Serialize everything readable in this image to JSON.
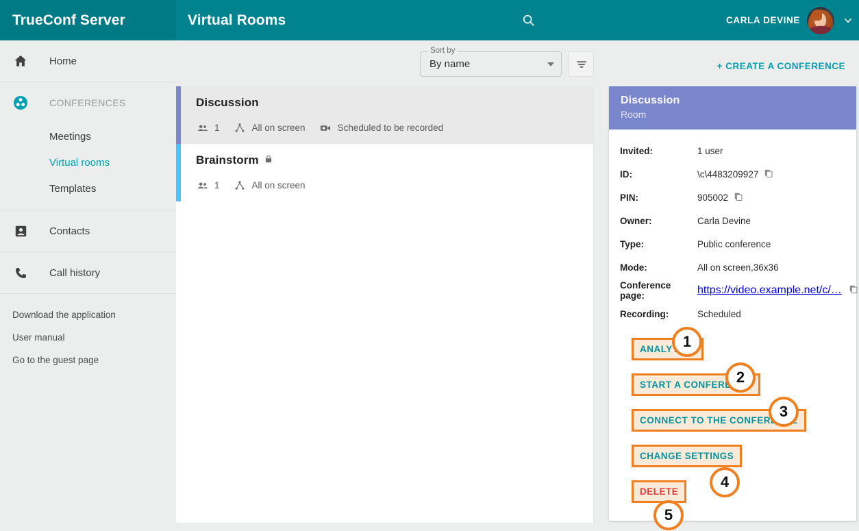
{
  "topbar": {
    "brand": "TrueConf Server",
    "page_title": "Virtual Rooms",
    "search_icon": "search-icon",
    "user_name": "CARLA DEVINE",
    "chevron": "❯"
  },
  "sidebar": {
    "home": {
      "label": "Home",
      "icon": "home-icon"
    },
    "conferences": {
      "label": "CONFERENCES",
      "icon": "conference-group-icon"
    },
    "sub_items": [
      {
        "label": "Meetings",
        "active": false
      },
      {
        "label": "Virtual rooms",
        "active": true
      },
      {
        "label": "Templates",
        "active": false
      }
    ],
    "contacts": {
      "label": "Contacts",
      "icon": "contact-card-icon"
    },
    "call_history": {
      "label": "Call history",
      "icon": "phone-icon"
    },
    "links": [
      "Download the application",
      "User manual",
      "Go to the guest page"
    ]
  },
  "toolbar": {
    "sort_legend": "Sort by",
    "sort_value": "By name",
    "sort_options": [
      "By name"
    ],
    "filter_icon": "filter-icon",
    "create_label": "+ CREATE A CONFERENCE"
  },
  "list": [
    {
      "title": "Discussion",
      "locked": false,
      "bar_color": "#7986cb",
      "selected": true,
      "meta": [
        {
          "icon": "group-icon",
          "text": "1"
        },
        {
          "icon": "topology-icon",
          "text": "All on screen"
        },
        {
          "icon": "video-camera-icon",
          "text": "Scheduled to be recorded"
        }
      ]
    },
    {
      "title": "Brainstorm",
      "locked": true,
      "lock_icon": "lock-icon",
      "bar_color": "#4fc3f7",
      "selected": false,
      "meta": [
        {
          "icon": "group-icon",
          "text": "1"
        },
        {
          "icon": "topology-icon",
          "text": "All on screen"
        }
      ]
    }
  ],
  "detail": {
    "title": "Discussion",
    "subtitle": "Room",
    "header_color": "#7986cb",
    "rows": [
      {
        "label": "Invited:",
        "value": "1 user",
        "copy": false
      },
      {
        "label": "ID:",
        "value": "\\c\\4483209927",
        "copy": true
      },
      {
        "label": "PIN:",
        "value": "905002",
        "copy": true
      },
      {
        "label": "Owner:",
        "value": "Carla Devine",
        "copy": false
      },
      {
        "label": "Type:",
        "value": "Public conference",
        "copy": false
      },
      {
        "label": "Mode:",
        "value": "All on screen,36x36",
        "copy": false
      },
      {
        "label": "Conference page:",
        "value": "https://video.example.net/c/…",
        "copy": true,
        "link": true
      },
      {
        "label": "Recording:",
        "value": "Scheduled",
        "copy": false
      }
    ],
    "actions": [
      {
        "label": "ANALYTICS",
        "badge": "1",
        "danger": false
      },
      {
        "label": "START A CONFERENCE",
        "badge": "2",
        "danger": false
      },
      {
        "label": "CONNECT TO THE CONFERENCE",
        "badge": "3",
        "danger": false
      },
      {
        "label": "CHANGE SETTINGS",
        "badge": "4",
        "danger": false
      },
      {
        "label": "DELETE",
        "badge": "5",
        "danger": true
      }
    ]
  },
  "colors": {
    "brand_teal": "#00838f",
    "accent_teal": "#00a0b0",
    "annotation_orange": "#ef8022",
    "annotation_fill": "#fbead8",
    "danger_red": "#e03b3b",
    "selected_bar": "#7986cb",
    "alt_bar": "#4fc3f7"
  }
}
